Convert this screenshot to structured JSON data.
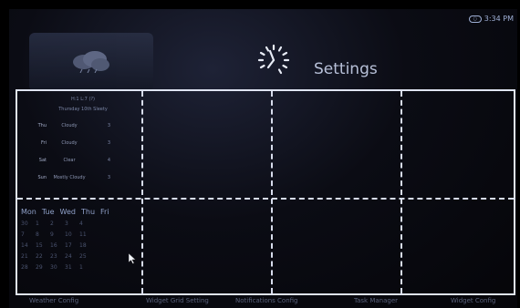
{
  "status": {
    "network_icon": "wifi-icon",
    "time": "3:34 PM"
  },
  "header": {
    "title": "Settings",
    "icon": "clock-icon"
  },
  "forecast": {
    "header_line1": "H:1   L:7   (?)",
    "header_line2": "Thursday 10th   Sleety",
    "rows": [
      {
        "day": "Thu",
        "condition": "Cloudy",
        "temp": "3"
      },
      {
        "day": "Fri",
        "condition": "Cloudy",
        "temp": "3"
      },
      {
        "day": "Sat",
        "condition": "Clear",
        "temp": "4"
      },
      {
        "day": "Sun",
        "condition": "Mostly Cloudy",
        "temp": "3"
      }
    ]
  },
  "calendar": {
    "days": [
      "Mon",
      "Tue",
      "Wed",
      "Thu",
      "Fri"
    ],
    "rows": [
      [
        "30",
        "1",
        "2",
        "3",
        "4"
      ],
      [
        "7",
        "8",
        "9",
        "10",
        "11"
      ],
      [
        "14",
        "15",
        "16",
        "17",
        "18"
      ],
      [
        "21",
        "22",
        "23",
        "24",
        "25"
      ],
      [
        "28",
        "29",
        "30",
        "31",
        "1"
      ]
    ]
  },
  "bottom_labels": [
    "Weather Config",
    "Widget Grid Setting",
    "Notifications Config",
    "Task Manager",
    "Widget Config"
  ]
}
